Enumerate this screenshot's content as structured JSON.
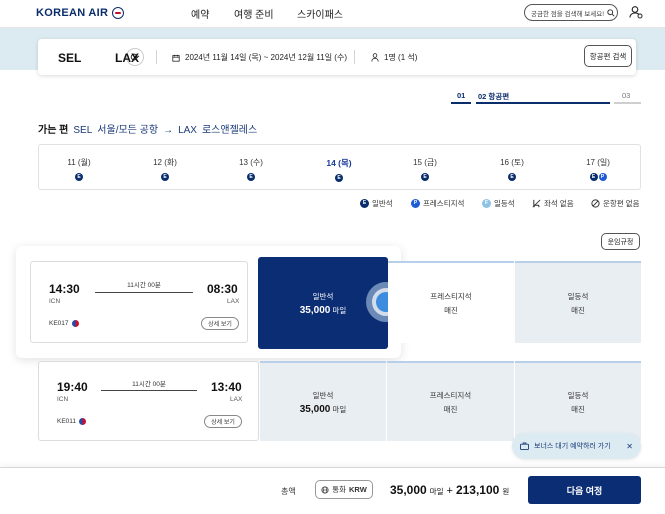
{
  "header": {
    "logo": "KOREAN AIR",
    "nav": [
      "예약",
      "여행 준비",
      "스카이패스"
    ],
    "search_placeholder": "궁금한 점을 검색해 보세요!"
  },
  "search": {
    "origin": "SEL",
    "destination": "LAX",
    "dates": "2024년 11월 14일 (목) ~ 2024년 12월 11일 (수)",
    "passengers": "1명 (1 석)",
    "search_button": "항공편 검색"
  },
  "steps": {
    "current_num": "01",
    "current_label": "02  항공편",
    "next_num": "03"
  },
  "route": {
    "direction": "가는 편",
    "origin_code": "SEL",
    "origin_name": "서울/모든 공항",
    "arrow": "→",
    "dest_code": "LAX",
    "dest_name": "로스앤젤레스"
  },
  "date_strip": [
    {
      "label": "11 (월)",
      "classes": [
        "E"
      ],
      "selected": false
    },
    {
      "label": "12 (화)",
      "classes": [
        "E"
      ],
      "selected": false
    },
    {
      "label": "13 (수)",
      "classes": [
        "E"
      ],
      "selected": false
    },
    {
      "label": "14 (목)",
      "classes": [
        "E"
      ],
      "selected": true
    },
    {
      "label": "15 (금)",
      "classes": [
        "E"
      ],
      "selected": false
    },
    {
      "label": "16 (토)",
      "classes": [
        "E"
      ],
      "selected": false
    },
    {
      "label": "17 (일)",
      "classes": [
        "E",
        "P"
      ],
      "selected": false
    }
  ],
  "legend": {
    "economy": "일반석",
    "prestige": "프레스티지석",
    "first": "일등석",
    "no_seat": "좌석 없음",
    "no_flight": "운항편 없음"
  },
  "rules_button": "운임규정",
  "flights": [
    {
      "dep_time": "14:30",
      "dep_airport": "ICN",
      "arr_time": "08:30",
      "arr_airport": "LAX",
      "duration": "11시간 00분",
      "flight_no": "KE017",
      "detail_button": "상세 보기",
      "fares": [
        {
          "name": "일반석",
          "value": "35,000",
          "unit": "마일"
        },
        {
          "name": "프레스티지석",
          "value": "매진",
          "unit": ""
        },
        {
          "name": "일등석",
          "value": "매진",
          "unit": ""
        }
      ]
    },
    {
      "dep_time": "19:40",
      "dep_airport": "ICN",
      "arr_time": "13:40",
      "arr_airport": "LAX",
      "duration": "11시간 00분",
      "flight_no": "KE011",
      "detail_button": "상세 보기",
      "fares": [
        {
          "name": "일반석",
          "value": "35,000",
          "unit": "마일"
        },
        {
          "name": "프레스티지석",
          "value": "매진",
          "unit": ""
        },
        {
          "name": "일등석",
          "value": "매진",
          "unit": ""
        }
      ]
    }
  ],
  "toast": {
    "text": "보너스 대기 예약하러 가기"
  },
  "footer": {
    "total_label": "총액",
    "currency_label": "통화",
    "currency_value": "KRW",
    "miles": "35,000",
    "miles_unit": "마일",
    "plus": "+",
    "won": "213,100",
    "won_unit": "원",
    "next_button": "다음 여정"
  },
  "colors": {
    "primary_navy": "#0b2d74",
    "accent_blue": "#3c8de0",
    "band": "#dcebf1"
  }
}
